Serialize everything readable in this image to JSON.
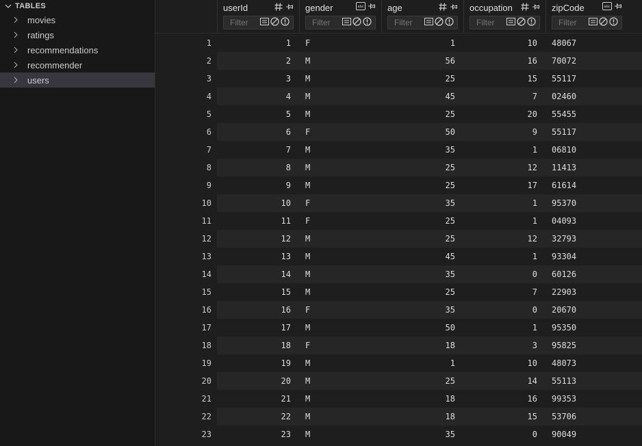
{
  "sidebar": {
    "section_label": "TABLES",
    "items": [
      {
        "label": "movies"
      },
      {
        "label": "ratings"
      },
      {
        "label": "recommendations"
      },
      {
        "label": "recommender"
      },
      {
        "label": "users"
      }
    ],
    "selected": "users"
  },
  "table": {
    "filter_placeholder": "Filter",
    "columns": [
      {
        "name": "userId",
        "type_icon": "hash-icon"
      },
      {
        "name": "gender",
        "type_icon": "abc-icon"
      },
      {
        "name": "age",
        "type_icon": "hash-icon"
      },
      {
        "name": "occupation",
        "type_icon": "hash-icon"
      },
      {
        "name": "zipCode",
        "type_icon": "abc-icon"
      }
    ],
    "rows": [
      {
        "n": "1",
        "userId": "1",
        "gender": "F",
        "age": "1",
        "occupation": "10",
        "zipCode": "48067"
      },
      {
        "n": "2",
        "userId": "2",
        "gender": "M",
        "age": "56",
        "occupation": "16",
        "zipCode": "70072"
      },
      {
        "n": "3",
        "userId": "3",
        "gender": "M",
        "age": "25",
        "occupation": "15",
        "zipCode": "55117"
      },
      {
        "n": "4",
        "userId": "4",
        "gender": "M",
        "age": "45",
        "occupation": "7",
        "zipCode": "02460"
      },
      {
        "n": "5",
        "userId": "5",
        "gender": "M",
        "age": "25",
        "occupation": "20",
        "zipCode": "55455"
      },
      {
        "n": "6",
        "userId": "6",
        "gender": "F",
        "age": "50",
        "occupation": "9",
        "zipCode": "55117"
      },
      {
        "n": "7",
        "userId": "7",
        "gender": "M",
        "age": "35",
        "occupation": "1",
        "zipCode": "06810"
      },
      {
        "n": "8",
        "userId": "8",
        "gender": "M",
        "age": "25",
        "occupation": "12",
        "zipCode": "11413"
      },
      {
        "n": "9",
        "userId": "9",
        "gender": "M",
        "age": "25",
        "occupation": "17",
        "zipCode": "61614"
      },
      {
        "n": "10",
        "userId": "10",
        "gender": "F",
        "age": "35",
        "occupation": "1",
        "zipCode": "95370"
      },
      {
        "n": "11",
        "userId": "11",
        "gender": "F",
        "age": "25",
        "occupation": "1",
        "zipCode": "04093"
      },
      {
        "n": "12",
        "userId": "12",
        "gender": "M",
        "age": "25",
        "occupation": "12",
        "zipCode": "32793"
      },
      {
        "n": "13",
        "userId": "13",
        "gender": "M",
        "age": "45",
        "occupation": "1",
        "zipCode": "93304"
      },
      {
        "n": "14",
        "userId": "14",
        "gender": "M",
        "age": "35",
        "occupation": "0",
        "zipCode": "60126"
      },
      {
        "n": "15",
        "userId": "15",
        "gender": "M",
        "age": "25",
        "occupation": "7",
        "zipCode": "22903"
      },
      {
        "n": "16",
        "userId": "16",
        "gender": "F",
        "age": "35",
        "occupation": "0",
        "zipCode": "20670"
      },
      {
        "n": "17",
        "userId": "17",
        "gender": "M",
        "age": "50",
        "occupation": "1",
        "zipCode": "95350"
      },
      {
        "n": "18",
        "userId": "18",
        "gender": "F",
        "age": "18",
        "occupation": "3",
        "zipCode": "95825"
      },
      {
        "n": "19",
        "userId": "19",
        "gender": "M",
        "age": "1",
        "occupation": "10",
        "zipCode": "48073"
      },
      {
        "n": "20",
        "userId": "20",
        "gender": "M",
        "age": "25",
        "occupation": "14",
        "zipCode": "55113"
      },
      {
        "n": "21",
        "userId": "21",
        "gender": "M",
        "age": "18",
        "occupation": "16",
        "zipCode": "99353"
      },
      {
        "n": "22",
        "userId": "22",
        "gender": "M",
        "age": "18",
        "occupation": "15",
        "zipCode": "53706"
      },
      {
        "n": "23",
        "userId": "23",
        "gender": "M",
        "age": "35",
        "occupation": "0",
        "zipCode": "90049"
      }
    ]
  },
  "colors": {
    "background": "#1e1e1e",
    "sidebar_background": "#181818",
    "selected_item": "#37373d",
    "alt_row": "#262626",
    "text": "#cccccc"
  }
}
